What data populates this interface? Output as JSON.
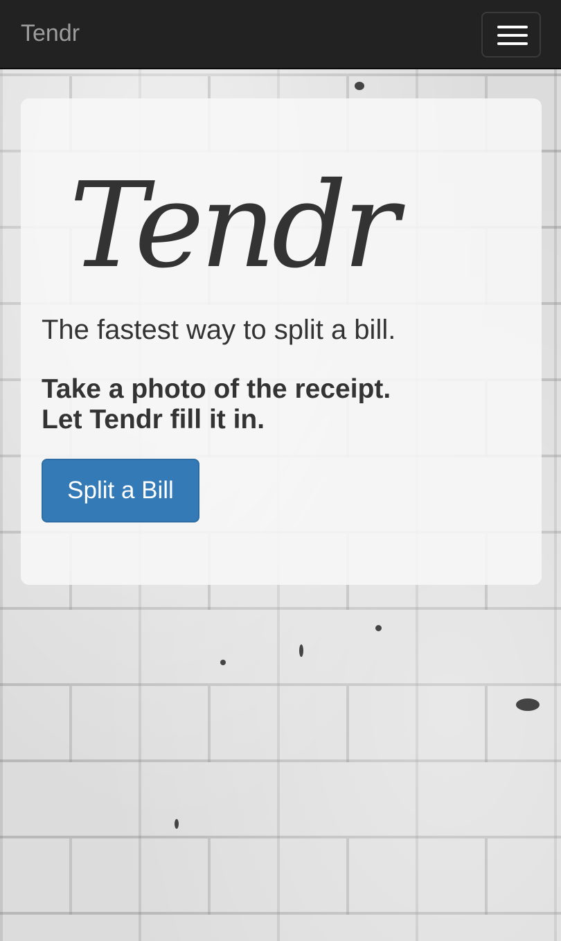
{
  "navbar": {
    "brand": "Tendr",
    "menu_icon": "hamburger-menu-icon"
  },
  "hero": {
    "logo_text": "Tendr",
    "tagline": "The fastest way to split a bill.",
    "headline_line1": "Take a photo of the receipt.",
    "headline_line2": "Let Tendr fill it in.",
    "cta_label": "Split a Bill"
  },
  "colors": {
    "navbar_bg": "#222222",
    "brand_text": "#9d9d9d",
    "primary_button": "#337ab7",
    "text": "#333333"
  }
}
